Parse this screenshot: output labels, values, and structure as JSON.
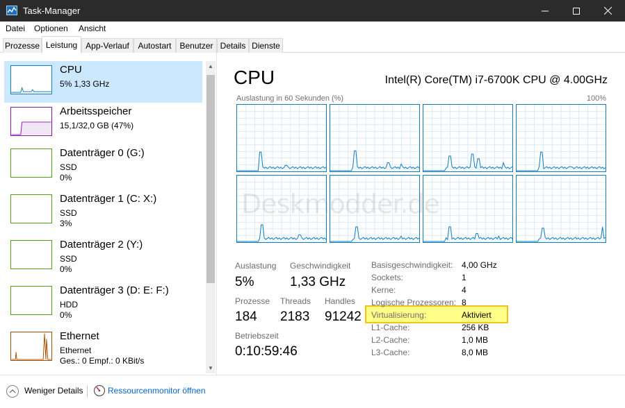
{
  "window": {
    "title": "Task-Manager"
  },
  "menu": [
    "Datei",
    "Optionen",
    "Ansicht"
  ],
  "tabs": [
    "Prozesse",
    "Leistung",
    "App-Verlauf",
    "Autostart",
    "Benutzer",
    "Details",
    "Dienste"
  ],
  "active_tab": "Leistung",
  "resources": [
    {
      "title": "CPU",
      "line1": "5%  1,33 GHz",
      "line2": "",
      "color": "#117dbb"
    },
    {
      "title": "Arbeitsspeicher",
      "line1": "15,1/32,0 GB (47%)",
      "line2": "",
      "color": "#8b12ae"
    },
    {
      "title": "Datenträger 0 (G:)",
      "line1": "SSD",
      "line2": "0%",
      "color": "#4da60c"
    },
    {
      "title": "Datenträger 1 (C: X:)",
      "line1": "SSD",
      "line2": "3%",
      "color": "#4da60c"
    },
    {
      "title": "Datenträger 2 (Y:)",
      "line1": "SSD",
      "line2": "0%",
      "color": "#4da60c"
    },
    {
      "title": "Datenträger 3 (D: E: F:)",
      "line1": "HDD",
      "line2": "0%",
      "color": "#4da60c"
    },
    {
      "title": "Ethernet",
      "line1": "Ethernet",
      "line2": "Ges.: 0 Empf.: 0 KBit/s",
      "color": "#a74f01"
    }
  ],
  "cpu": {
    "title": "CPU",
    "model": "Intel(R) Core(TM) i7-6700K CPU @ 4.00GHz",
    "graph_caption": "Auslastung in 60 Sekunden (%)",
    "graph_max": "100%",
    "watermark": "Deskmodder.de",
    "stats": {
      "auslastung_label": "Auslastung",
      "auslastung": "5%",
      "geschwindigkeit_label": "Geschwindigkeit",
      "geschwindigkeit": "1,33 GHz",
      "prozesse_label": "Prozesse",
      "prozesse": "184",
      "threads_label": "Threads",
      "threads": "2183",
      "handles_label": "Handles",
      "handles": "91242",
      "betriebszeit_label": "Betriebszeit",
      "betriebszeit": "0:10:59:46"
    },
    "details": [
      {
        "label": "Basisgeschwindigkeit:",
        "value": "4,00 GHz"
      },
      {
        "label": "Sockets:",
        "value": "1"
      },
      {
        "label": "Kerne:",
        "value": "4"
      },
      {
        "label": "Logische Prozessoren:",
        "value": "8"
      },
      {
        "label": "Virtualisierung:",
        "value": "Aktiviert"
      },
      {
        "label": "L1-Cache:",
        "value": "256 KB"
      },
      {
        "label": "L2-Cache:",
        "value": "1,0 MB"
      },
      {
        "label": "L3-Cache:",
        "value": "8,0 MB"
      }
    ],
    "core_count": 8,
    "line_color": "#117dbb"
  },
  "footer": {
    "fewer_details": "Weniger Details",
    "resmon": "Ressourcenmonitor öffnen"
  }
}
